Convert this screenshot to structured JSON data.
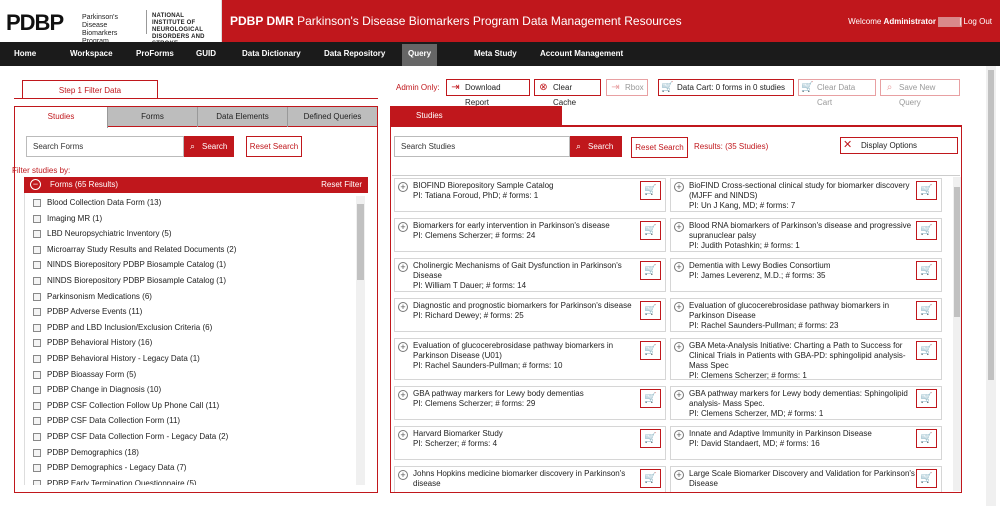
{
  "header": {
    "logo_text": "PDBP",
    "logo_subtitle": "Parkinson's Disease Biomarkers Program",
    "ninds_text": "NATIONAL INSTITUTE OF NEUROLOGICAL DISORDERS AND STROKE",
    "banner_bold": "PDBP DMR",
    "banner_rest": " Parkinson's Disease Biomarkers Program Data Management Resources",
    "welcome_prefix": "Welcome ",
    "welcome_user": "Administrator",
    "logout": "| Log Out"
  },
  "nav": [
    "Home",
    "Workspace",
    "ProForms",
    "GUID",
    "Data Dictionary",
    "Data Repository",
    "Query",
    "Meta Study",
    "Account Management"
  ],
  "active_nav": "Query",
  "step_tab": "Step 1 Filter Data",
  "toolbar": {
    "admin_label": "Admin Only:",
    "download_report": "Download Report",
    "clear_cache": "Clear Cache",
    "rbox": "Rbox",
    "data_cart": "Data Cart:  0  forms in  0  studies",
    "clear_data_cart": "Clear Data Cart",
    "save_new_query": "Save New Query"
  },
  "left_tabs": [
    "Studies",
    "Forms",
    "Data Elements",
    "Defined Queries"
  ],
  "left_search": {
    "placeholder": "Search Forms",
    "button": "Search",
    "reset": "Reset Search"
  },
  "filter_label": "Filter studies by:",
  "forms_bar": {
    "title": "Forms   (65 Results)",
    "reset": "Reset Filter"
  },
  "form_items": [
    "Blood Collection Data Form (13)",
    "Imaging MR (1)",
    "LBD Neuropsychiatric Inventory (5)",
    "Microarray Study Results and Related Documents (2)",
    "NINDS Biorepository PDBP Biosample Catalog (1)",
    "NINDS Biorepository PDBP Biosample Catalog (1)",
    "Parkinsonism Medications (6)",
    "PDBP Adverse Events (11)",
    "PDBP and LBD Inclusion/Exclusion Criteria (6)",
    "PDBP Behavioral History (16)",
    "PDBP Behavioral History - Legacy Data (1)",
    "PDBP Bioassay Form (5)",
    "PDBP Change in Diagnosis (10)",
    "PDBP CSF Collection Follow Up Phone Call (11)",
    "PDBP CSF Data Collection Form (11)",
    "PDBP CSF Data Collection Form - Legacy Data (2)",
    "PDBP Demographics (18)",
    "PDBP Demographics - Legacy Data (7)",
    "PDBP Early Termination Questionnaire (5)"
  ],
  "right_tab": "Studies",
  "right_search": {
    "placeholder": "Search Studies",
    "button": "Search",
    "reset": "Reset Search"
  },
  "results": "Results: (35 Studies)",
  "display_options": "Display Options",
  "studies_left": [
    {
      "title": "BIOFIND Biorepository Sample Catalog",
      "pi": "PI: Tatiana Foroud, PhD; # forms: 1"
    },
    {
      "title": "Biomarkers for early intervention in Parkinson's disease",
      "pi": "PI: Clemens Scherzer; # forms: 24"
    },
    {
      "title": "Cholinergic Mechanisms of Gait Dysfunction in Parkinson's Disease",
      "pi": "PI: William T Dauer; # forms: 14"
    },
    {
      "title": "Diagnostic and prognostic biomarkers for Parkinson's disease",
      "pi": "PI: Richard Dewey; # forms: 25"
    },
    {
      "title": "Evaluation of glucocerebrosidase pathway biomarkers in Parkinson Disease (U01)",
      "pi": "PI: Rachel Saunders-Pullman; # forms: 10"
    },
    {
      "title": "GBA pathway markers for Lewy body dementias",
      "pi": "PI: Clemens Scherzer; # forms: 29"
    },
    {
      "title": "Harvard Biomarker Study",
      "pi": "PI: Scherzer; # forms: 4"
    },
    {
      "title": "Johns Hopkins medicine biomarker discovery in Parkinson's disease",
      "pi": ""
    }
  ],
  "studies_right": [
    {
      "title": "BioFIND Cross-sectional clinical study for biomarker discovery (MJFF and NINDS)",
      "pi": "PI: Un J Kang, MD; # forms: 7"
    },
    {
      "title": "Blood RNA biomarkers of Parkinson's disease and progressive supranuclear palsy",
      "pi": "PI: Judith Potashkin; # forms: 1"
    },
    {
      "title": "Dementia with Lewy Bodies Consortium",
      "pi": "PI: James Leverenz, M.D.; # forms: 35"
    },
    {
      "title": "Evaluation of glucocerebrosidase pathway biomarkers in Parkinson Disease",
      "pi": "PI: Rachel Saunders-Pullman; # forms: 23"
    },
    {
      "title": "GBA Meta-Analysis Initiative: Charting a Path to Success for Clinical Trials in Patients with GBA-PD: sphingolipid analysis- Mass Spec",
      "pi": "PI: Clemens Scherzer; # forms: 1"
    },
    {
      "title": "GBA pathway markers for Lewy body dementias: Sphingolipid analysis- Mass Spec.",
      "pi": "PI: Clemens Scherzer, MD; # forms: 1"
    },
    {
      "title": "Innate and Adaptive Immunity in Parkinson Disease",
      "pi": "PI: David Standaert, MD; # forms: 16"
    },
    {
      "title": "Large Scale Biomarker Discovery and Validation for Parkinson's Disease",
      "pi": ""
    }
  ]
}
